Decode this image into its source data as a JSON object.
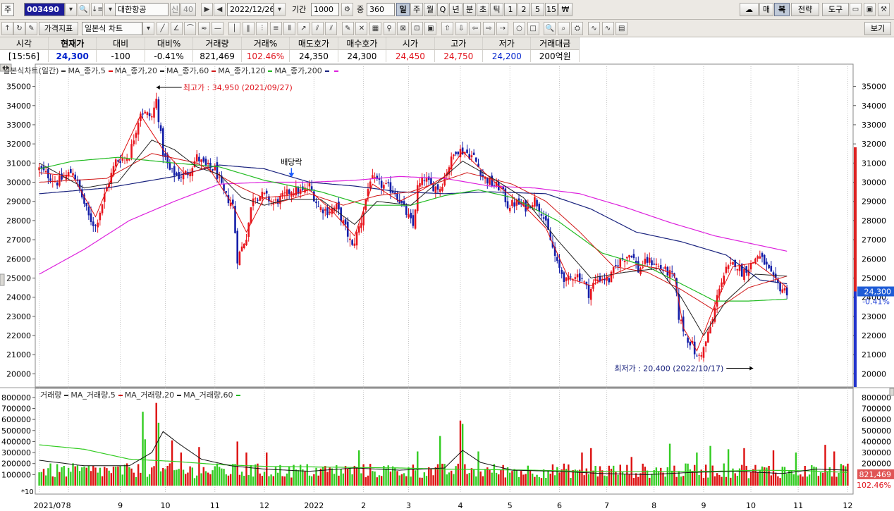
{
  "toolbar": {
    "market_label": "주",
    "code": "003490",
    "stock_name": "대한항공",
    "credit_badge": "신",
    "margin_badge": "40",
    "date": "2022/12/26",
    "period_label": "기간",
    "period_value": "1000",
    "count_label": "중",
    "count_value": "360",
    "period_buttons": [
      "일",
      "주",
      "월",
      "Q",
      "년",
      "분",
      "초",
      "틱",
      "1",
      "2",
      "5",
      "15",
      "₩"
    ],
    "active_period": "일",
    "right_buttons": [
      "매",
      "복",
      "전략",
      "도구"
    ],
    "active_right": "복"
  },
  "toolbar2": {
    "indicator_button": "가격지표",
    "chart_type": "일본식 차트",
    "view_button": "보기"
  },
  "quote": {
    "headers": [
      "시각",
      "현재가",
      "대비",
      "대비%",
      "거래량",
      "거래%",
      "매도호가",
      "매수호가",
      "시가",
      "고가",
      "저가",
      "거래대금"
    ],
    "values": [
      "[15:56]",
      "24,300",
      "-100",
      "-0.41%",
      "821,469",
      "102.46%",
      "24,350",
      "24,300",
      "24,450",
      "24,750",
      "24,200",
      "200억원"
    ]
  },
  "legend": {
    "price": [
      {
        "text": "일본식차트(일간)",
        "color": "#333333"
      },
      {
        "text": "MA_종가,5",
        "color": "#e01010"
      },
      {
        "text": "MA_종가,20",
        "color": "#222222"
      },
      {
        "text": "MA_종가,60",
        "color": "#d01818"
      },
      {
        "text": "MA_종가,120",
        "color": "#22bb22"
      },
      {
        "text": "MA_종가,200",
        "color": "#1a237e"
      },
      {
        "text": "",
        "color": "#dd22dd"
      }
    ],
    "volume": [
      {
        "text": "거래량",
        "color": "#333333"
      },
      {
        "text": "MA_거래량,5",
        "color": "#d01818"
      },
      {
        "text": "MA_거래량,20",
        "color": "#222222"
      },
      {
        "text": "MA_거래량,60",
        "color": "#22bb22"
      }
    ]
  },
  "annotations": {
    "high": "최고가 : 34,950 (2021/09/27)",
    "low": "최저가 : 20,400 (2022/10/17)",
    "dividend": "배당락",
    "last_price": "24,300",
    "last_change": "-0.41%",
    "last_volume": "821,469",
    "last_volume_pct": "102.46%",
    "vol_scale_note": "*10"
  },
  "chart_data": {
    "type": "candlestick",
    "price_axis": {
      "min": 19500,
      "max": 35500,
      "ticks": [
        20000,
        21000,
        22000,
        23000,
        24000,
        25000,
        26000,
        27000,
        28000,
        29000,
        30000,
        31000,
        32000,
        33000,
        34000,
        35000
      ]
    },
    "volume_axis": {
      "min": 0,
      "max": 850000,
      "ticks": [
        100000,
        200000,
        300000,
        400000,
        500000,
        600000,
        700000,
        800000
      ]
    },
    "x_axis_labels": [
      {
        "label": "2021/07",
        "i": 0
      },
      {
        "label": "8",
        "i": 13
      },
      {
        "label": "9",
        "i": 36
      },
      {
        "label": "10",
        "i": 56
      },
      {
        "label": "11",
        "i": 78
      },
      {
        "label": "12",
        "i": 100
      },
      {
        "label": "2022",
        "i": 122
      },
      {
        "label": "2",
        "i": 144
      },
      {
        "label": "3",
        "i": 164
      },
      {
        "label": "4",
        "i": 187
      },
      {
        "label": "5",
        "i": 209
      },
      {
        "label": "6",
        "i": 231
      },
      {
        "label": "7",
        "i": 252
      },
      {
        "label": "8",
        "i": 273
      },
      {
        "label": "9",
        "i": 295
      },
      {
        "label": "10",
        "i": 316
      },
      {
        "label": "11",
        "i": 337
      },
      {
        "label": "12",
        "i": 359
      }
    ],
    "close_anchors": [
      [
        0,
        30700
      ],
      [
        8,
        30000
      ],
      [
        15,
        30600
      ],
      [
        22,
        28200
      ],
      [
        25,
        27700
      ],
      [
        30,
        29700
      ],
      [
        34,
        31100
      ],
      [
        40,
        31400
      ],
      [
        45,
        33700
      ],
      [
        50,
        33400
      ],
      [
        52,
        34300
      ],
      [
        55,
        31500
      ],
      [
        58,
        30600
      ],
      [
        62,
        30300
      ],
      [
        66,
        30500
      ],
      [
        70,
        31300
      ],
      [
        74,
        30800
      ],
      [
        78,
        30700
      ],
      [
        82,
        29400
      ],
      [
        86,
        28800
      ],
      [
        88,
        26000
      ],
      [
        92,
        27200
      ],
      [
        95,
        29300
      ],
      [
        100,
        29300
      ],
      [
        104,
        28900
      ],
      [
        108,
        29200
      ],
      [
        112,
        29600
      ],
      [
        117,
        29500
      ],
      [
        120,
        29800
      ],
      [
        124,
        28700
      ],
      [
        128,
        28500
      ],
      [
        132,
        28700
      ],
      [
        136,
        27600
      ],
      [
        139,
        26600
      ],
      [
        143,
        28000
      ],
      [
        147,
        30200
      ],
      [
        151,
        29900
      ],
      [
        155,
        29700
      ],
      [
        158,
        29500
      ],
      [
        162,
        28600
      ],
      [
        166,
        27700
      ],
      [
        168,
        29700
      ],
      [
        171,
        30200
      ],
      [
        174,
        29800
      ],
      [
        178,
        29700
      ],
      [
        181,
        30600
      ],
      [
        185,
        31700
      ],
      [
        189,
        31600
      ],
      [
        193,
        31300
      ],
      [
        197,
        30300
      ],
      [
        201,
        29900
      ],
      [
        205,
        29700
      ],
      [
        208,
        28800
      ],
      [
        212,
        28900
      ],
      [
        216,
        28700
      ],
      [
        220,
        29100
      ],
      [
        223,
        28500
      ],
      [
        226,
        27400
      ],
      [
        230,
        25700
      ],
      [
        234,
        24800
      ],
      [
        238,
        25200
      ],
      [
        241,
        25000
      ],
      [
        244,
        24200
      ],
      [
        247,
        24900
      ],
      [
        250,
        25000
      ],
      [
        253,
        24900
      ],
      [
        257,
        25800
      ],
      [
        260,
        26100
      ],
      [
        263,
        26300
      ],
      [
        266,
        25400
      ],
      [
        270,
        25900
      ],
      [
        273,
        25800
      ],
      [
        276,
        25500
      ],
      [
        279,
        25300
      ],
      [
        282,
        25000
      ],
      [
        284,
        23000
      ],
      [
        287,
        22000
      ],
      [
        290,
        21500
      ],
      [
        292,
        20800
      ],
      [
        295,
        21300
      ],
      [
        299,
        22800
      ],
      [
        302,
        24600
      ],
      [
        305,
        25400
      ],
      [
        309,
        25800
      ],
      [
        312,
        25300
      ],
      [
        316,
        25700
      ],
      [
        319,
        26200
      ],
      [
        322,
        25800
      ],
      [
        326,
        24900
      ],
      [
        329,
        24500
      ],
      [
        332,
        24300
      ]
    ],
    "ma_series": {
      "ma5": [
        [
          0,
          30500
        ],
        [
          15,
          30300
        ],
        [
          25,
          28200
        ],
        [
          35,
          31000
        ],
        [
          45,
          33500
        ],
        [
          55,
          31700
        ],
        [
          65,
          30400
        ],
        [
          75,
          30800
        ],
        [
          85,
          29000
        ],
        [
          92,
          27400
        ],
        [
          100,
          29200
        ],
        [
          110,
          29300
        ],
        [
          120,
          29600
        ],
        [
          130,
          28500
        ],
        [
          140,
          27200
        ],
        [
          148,
          29900
        ],
        [
          160,
          29000
        ],
        [
          170,
          29600
        ],
        [
          180,
          30300
        ],
        [
          188,
          31600
        ],
        [
          195,
          30800
        ],
        [
          205,
          29700
        ],
        [
          215,
          28800
        ],
        [
          225,
          27600
        ],
        [
          235,
          25000
        ],
        [
          245,
          24600
        ],
        [
          255,
          25200
        ],
        [
          265,
          25700
        ],
        [
          275,
          25500
        ],
        [
          282,
          25200
        ],
        [
          286,
          22400
        ],
        [
          292,
          21200
        ],
        [
          300,
          23600
        ],
        [
          308,
          25600
        ],
        [
          318,
          25800
        ],
        [
          326,
          25100
        ],
        [
          332,
          24500
        ]
      ],
      "ma20": [
        [
          0,
          31000
        ],
        [
          20,
          29700
        ],
        [
          35,
          30000
        ],
        [
          50,
          32200
        ],
        [
          60,
          31700
        ],
        [
          70,
          30800
        ],
        [
          80,
          30400
        ],
        [
          90,
          29200
        ],
        [
          100,
          28800
        ],
        [
          110,
          29100
        ],
        [
          125,
          29100
        ],
        [
          140,
          27800
        ],
        [
          150,
          29000
        ],
        [
          165,
          28800
        ],
        [
          175,
          29800
        ],
        [
          188,
          31100
        ],
        [
          200,
          30300
        ],
        [
          215,
          29200
        ],
        [
          230,
          27000
        ],
        [
          245,
          25000
        ],
        [
          260,
          25300
        ],
        [
          275,
          25500
        ],
        [
          285,
          24000
        ],
        [
          295,
          22000
        ],
        [
          305,
          23800
        ],
        [
          318,
          25200
        ],
        [
          332,
          25100
        ]
      ],
      "ma60": [
        [
          0,
          30000
        ],
        [
          30,
          30200
        ],
        [
          50,
          31500
        ],
        [
          70,
          31000
        ],
        [
          90,
          29700
        ],
        [
          105,
          28900
        ],
        [
          120,
          29400
        ],
        [
          135,
          28800
        ],
        [
          150,
          29300
        ],
        [
          165,
          29500
        ],
        [
          180,
          30100
        ],
        [
          190,
          30500
        ],
        [
          210,
          29900
        ],
        [
          225,
          29000
        ],
        [
          240,
          27400
        ],
        [
          255,
          25600
        ],
        [
          270,
          25300
        ],
        [
          285,
          24400
        ],
        [
          300,
          23300
        ],
        [
          315,
          24500
        ],
        [
          332,
          25100
        ]
      ],
      "ma120": [
        [
          0,
          30700
        ],
        [
          15,
          31100
        ],
        [
          35,
          31300
        ],
        [
          60,
          31000
        ],
        [
          80,
          30800
        ],
        [
          100,
          30100
        ],
        [
          125,
          29500
        ],
        [
          145,
          28800
        ],
        [
          165,
          28800
        ],
        [
          180,
          29300
        ],
        [
          195,
          29600
        ],
        [
          210,
          29200
        ],
        [
          230,
          28000
        ],
        [
          250,
          26300
        ],
        [
          270,
          25600
        ],
        [
          285,
          24700
        ],
        [
          300,
          23800
        ],
        [
          315,
          23800
        ],
        [
          332,
          23900
        ]
      ],
      "ma200": [
        [
          0,
          29400
        ],
        [
          30,
          29700
        ],
        [
          60,
          30300
        ],
        [
          80,
          30900
        ],
        [
          100,
          30700
        ],
        [
          120,
          30000
        ],
        [
          140,
          29800
        ],
        [
          160,
          29500
        ],
        [
          180,
          29400
        ],
        [
          200,
          29500
        ],
        [
          225,
          29400
        ],
        [
          245,
          28600
        ],
        [
          265,
          27400
        ],
        [
          285,
          26900
        ],
        [
          305,
          26200
        ],
        [
          320,
          24900
        ],
        [
          332,
          24700
        ]
      ],
      "ma_long": [
        [
          0,
          25200
        ],
        [
          20,
          26500
        ],
        [
          40,
          28000
        ],
        [
          60,
          29000
        ],
        [
          80,
          29900
        ],
        [
          100,
          30000
        ],
        [
          120,
          30000
        ],
        [
          140,
          30100
        ],
        [
          160,
          30300
        ],
        [
          180,
          30200
        ],
        [
          200,
          29800
        ],
        [
          220,
          29700
        ],
        [
          240,
          29400
        ],
        [
          260,
          28700
        ],
        [
          280,
          27900
        ],
        [
          300,
          27200
        ],
        [
          320,
          26700
        ],
        [
          332,
          26400
        ]
      ]
    },
    "volume_baseline": 150000,
    "volume_spikes": [
      [
        46,
        670000
      ],
      [
        52,
        750000
      ],
      [
        53,
        570000
      ],
      [
        47,
        420000
      ],
      [
        59,
        410000
      ],
      [
        63,
        300000
      ],
      [
        71,
        350000
      ],
      [
        88,
        400000
      ],
      [
        92,
        300000
      ],
      [
        101,
        300000
      ],
      [
        142,
        320000
      ],
      [
        168,
        310000
      ],
      [
        178,
        450000
      ],
      [
        188,
        560000
      ],
      [
        187,
        590000
      ],
      [
        195,
        310000
      ],
      [
        241,
        300000
      ],
      [
        245,
        340000
      ],
      [
        263,
        260000
      ],
      [
        280,
        380000
      ],
      [
        292,
        300000
      ],
      [
        298,
        360000
      ],
      [
        306,
        330000
      ],
      [
        313,
        340000
      ],
      [
        326,
        320000
      ],
      [
        336,
        300000
      ],
      [
        349,
        370000
      ],
      [
        353,
        310000
      ]
    ],
    "volume_ma60": [
      [
        0,
        370000
      ],
      [
        20,
        330000
      ],
      [
        40,
        240000
      ],
      [
        60,
        220000
      ],
      [
        80,
        190000
      ],
      [
        100,
        175000
      ],
      [
        120,
        170000
      ],
      [
        140,
        165000
      ],
      [
        160,
        160000
      ],
      [
        180,
        150000
      ],
      [
        200,
        145000
      ],
      [
        220,
        140000
      ],
      [
        240,
        130000
      ],
      [
        260,
        125000
      ],
      [
        280,
        130000
      ],
      [
        300,
        130000
      ],
      [
        320,
        140000
      ],
      [
        340,
        135000
      ],
      [
        359,
        120000
      ]
    ],
    "volume_ma20": [
      [
        0,
        230000
      ],
      [
        20,
        180000
      ],
      [
        40,
        180000
      ],
      [
        50,
        300000
      ],
      [
        55,
        490000
      ],
      [
        62,
        380000
      ],
      [
        72,
        240000
      ],
      [
        85,
        180000
      ],
      [
        100,
        150000
      ],
      [
        120,
        130000
      ],
      [
        140,
        160000
      ],
      [
        160,
        140000
      ],
      [
        180,
        160000
      ],
      [
        188,
        320000
      ],
      [
        196,
        210000
      ],
      [
        210,
        140000
      ],
      [
        230,
        130000
      ],
      [
        250,
        110000
      ],
      [
        270,
        100000
      ],
      [
        290,
        120000
      ],
      [
        310,
        130000
      ],
      [
        330,
        110000
      ],
      [
        345,
        150000
      ],
      [
        359,
        140000
      ]
    ],
    "colors": {
      "up": "#e8141d",
      "down": "#141ea8",
      "ma5": "#e01010",
      "ma20": "#222222",
      "ma60": "#d01818",
      "ma120": "#22bb22",
      "ma200": "#1a237e",
      "ma_long": "#dd22dd",
      "vol_up": "#dd1111",
      "vol_down": "#33cc22"
    }
  }
}
